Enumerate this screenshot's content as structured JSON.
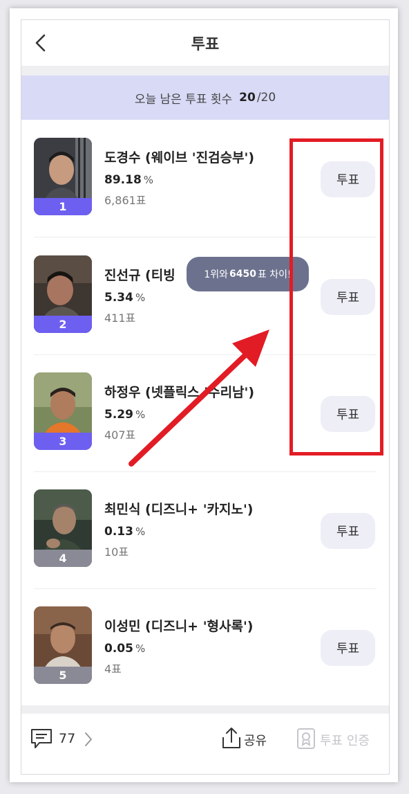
{
  "header": {
    "title": "투표",
    "back_icon": "chevron-left-icon"
  },
  "remaining": {
    "label": "오늘 남은 투표 횟수",
    "count": "20",
    "total": "/20"
  },
  "vote_button_label": "투표",
  "candidates": [
    {
      "rank": "1",
      "name": "도경수 (웨이브 '진검승부')",
      "percent": "89.18",
      "unit": "%",
      "votes": "6,861표"
    },
    {
      "rank": "2",
      "name": "진선규 (티빙",
      "percent": "5.34",
      "unit": "%",
      "votes": "411표"
    },
    {
      "rank": "3",
      "name": "하정우 (넷플릭스 '수리남')",
      "percent": "5.29",
      "unit": "%",
      "votes": "407표"
    },
    {
      "rank": "4",
      "name": "최민식 (디즈니+ '카지노')",
      "percent": "0.13",
      "unit": "%",
      "votes": "10표"
    },
    {
      "rank": "5",
      "name": "이성민 (디즈니+ '형사록')",
      "percent": "0.05",
      "unit": "%",
      "votes": "4표"
    }
  ],
  "tooltip": {
    "prefix": "1위와",
    "number": "6450",
    "suffix": "표 차이!"
  },
  "footer": {
    "comment_count": "77",
    "share_label": "공유",
    "certify_label": "투표 인증"
  },
  "colors": {
    "accent": "#6d5ff0",
    "highlight": "#e21c25",
    "remain_bg": "#d8daf6"
  }
}
